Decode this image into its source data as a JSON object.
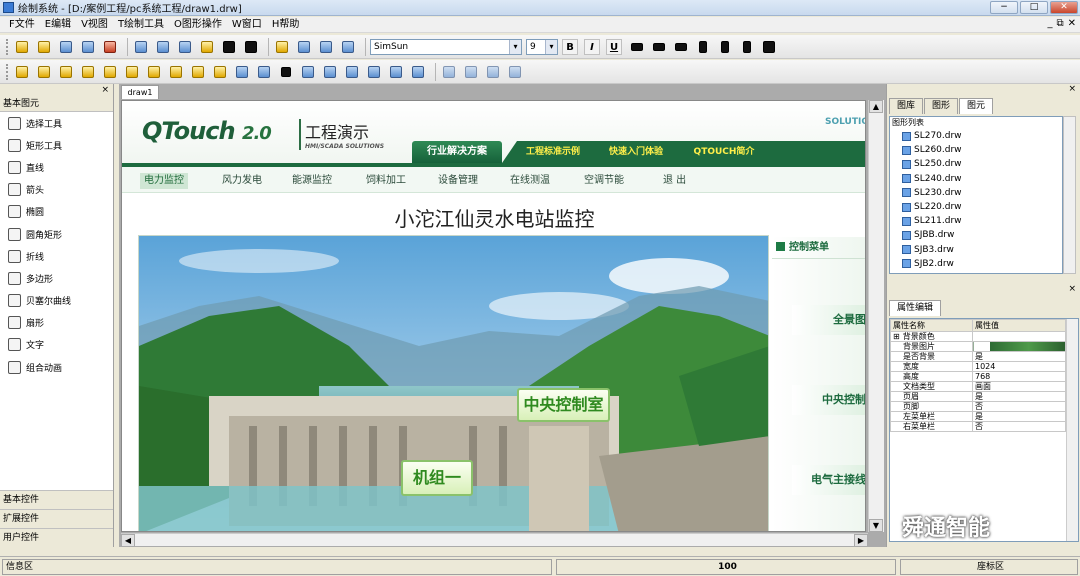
{
  "window": {
    "title": "绘制系统 - [D:/案例工程/pc系统工程/draw1.drw]",
    "min": "−",
    "max": "□",
    "close": "✕"
  },
  "menu": [
    "F文件",
    "E编辑",
    "V视图",
    "T绘制工具",
    "O图形操作",
    "W窗口",
    "H帮助"
  ],
  "mdi_controls": [
    "_",
    "⧉",
    "✕"
  ],
  "format_toolbar": {
    "font": "SimSun",
    "size": "9",
    "bold": "B",
    "italic": "I",
    "underline": "U"
  },
  "left_panel": {
    "close": "×",
    "category": "基本图元",
    "tools": [
      {
        "label": "选择工具",
        "icon": "pointer-icon"
      },
      {
        "label": "矩形工具",
        "icon": "rectangle-icon"
      },
      {
        "label": "直线",
        "icon": "line-icon"
      },
      {
        "label": "箭头",
        "icon": "arrow-icon"
      },
      {
        "label": "椭圆",
        "icon": "ellipse-icon"
      },
      {
        "label": "圆角矩形",
        "icon": "rounded-rect-icon"
      },
      {
        "label": "折线",
        "icon": "polyline-icon"
      },
      {
        "label": "多边形",
        "icon": "polygon-icon"
      },
      {
        "label": "贝塞尔曲线",
        "icon": "bezier-icon"
      },
      {
        "label": "扇形",
        "icon": "sector-icon"
      },
      {
        "label": "文字",
        "icon": "text-icon"
      },
      {
        "label": "组合动画",
        "icon": "animation-icon"
      }
    ],
    "bottom_categories": [
      "基本控件",
      "扩展控件",
      "用户控件"
    ]
  },
  "document": {
    "tab": "draw1",
    "web": {
      "logo": "QTouch",
      "logo_version": "2.0",
      "logo_title": "工程演示",
      "logo_subtitle": "HMI/SCADA SOLUTIONS",
      "solution_text": "SOLUTIO",
      "nav_tabs": [
        "行业解决方案",
        "工程标准示例",
        "快速入门体验",
        "QTOUCH简介"
      ],
      "sub_nav": [
        "电力监控",
        "风力发电",
        "能源监控",
        "饲料加工",
        "设备管理",
        "在线测温",
        "空调节能",
        "退 出"
      ],
      "page_title": "小沱江仙灵水电站监控",
      "scene_labels": {
        "control_room": "中央控制室",
        "unit_one": "机组一"
      },
      "control_menu": {
        "header": "控制菜单",
        "items": [
          "全景图",
          "中央控制",
          "电气主接线"
        ]
      }
    }
  },
  "right_panel": {
    "close": "×",
    "tabs": [
      "图库",
      "图形",
      "图元"
    ],
    "lib_title": "图形列表",
    "lib_items": [
      "SL270.drw",
      "SL260.drw",
      "SL250.drw",
      "SL240.drw",
      "SL230.drw",
      "SL220.drw",
      "SL211.drw",
      "SJBB.drw",
      "SJB3.drw",
      "SJB2.drw"
    ],
    "prop_tab": "属性编辑",
    "prop_headers": [
      "属性名称",
      "属性值"
    ],
    "props": [
      {
        "name": "背景颜色",
        "value": ""
      },
      {
        "name": "背景图片",
        "value": ""
      },
      {
        "name": "是否背景",
        "value": "是"
      },
      {
        "name": "宽度",
        "value": "1024"
      },
      {
        "name": "高度",
        "value": "768"
      },
      {
        "name": "文档类型",
        "value": "画面"
      },
      {
        "name": "页眉",
        "value": "是"
      },
      {
        "name": "页脚",
        "value": "否"
      },
      {
        "name": "左菜单栏",
        "value": "是"
      },
      {
        "name": "右菜单栏",
        "value": "否"
      }
    ],
    "expand_symbol": "⊞"
  },
  "status": {
    "info": "信息区",
    "zoom": "100",
    "coord": "座标区"
  },
  "watermark": "舜通智能"
}
